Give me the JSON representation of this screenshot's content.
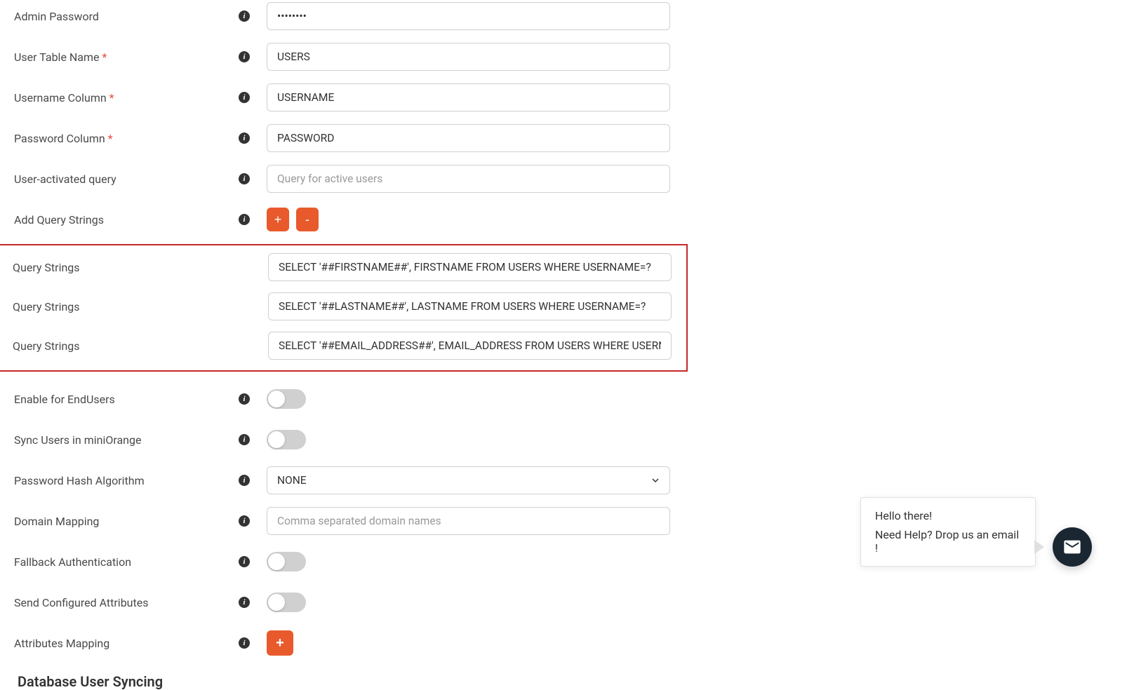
{
  "fields": {
    "admin_password": {
      "label": "Admin Password",
      "value": "••••••••"
    },
    "user_table": {
      "label": "User Table Name",
      "value": "USERS"
    },
    "username_col": {
      "label": "Username Column",
      "value": "USERNAME"
    },
    "password_col": {
      "label": "Password Column",
      "value": "PASSWORD"
    },
    "user_activated_query": {
      "label": "User-activated query",
      "placeholder": "Query for active users"
    },
    "add_query_strings": {
      "label": "Add Query Strings"
    },
    "query_string_1": {
      "label": "Query Strings",
      "value": "SELECT '##FIRSTNAME##', FIRSTNAME FROM USERS WHERE USERNAME=?"
    },
    "query_string_2": {
      "label": "Query Strings",
      "value": "SELECT '##LASTNAME##', LASTNAME FROM USERS WHERE USERNAME=?"
    },
    "query_string_3": {
      "label": "Query Strings",
      "value": "SELECT '##EMAIL_ADDRESS##', EMAIL_ADDRESS FROM USERS WHERE USERNAME=?"
    },
    "enable_endusers": {
      "label": "Enable for EndUsers"
    },
    "sync_users": {
      "label": "Sync Users in miniOrange"
    },
    "hash_algorithm": {
      "label": "Password Hash Algorithm",
      "value": "NONE"
    },
    "domain_mapping": {
      "label": "Domain Mapping",
      "placeholder": "Comma separated domain names"
    },
    "fallback_auth": {
      "label": "Fallback Authentication"
    },
    "send_attributes": {
      "label": "Send Configured Attributes"
    },
    "attributes_mapping": {
      "label": "Attributes Mapping"
    }
  },
  "buttons": {
    "plus": "+",
    "minus": "-"
  },
  "section_heading": "Database User Syncing",
  "chat": {
    "line1": "Hello there!",
    "line2": "Need Help? Drop us an email !"
  }
}
